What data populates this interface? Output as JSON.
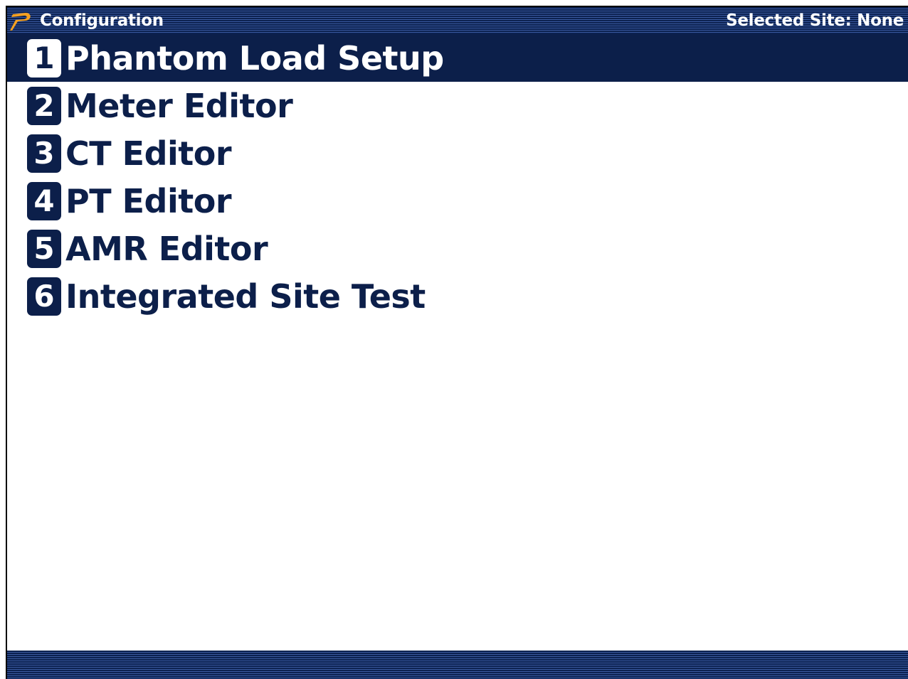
{
  "header": {
    "title": "Configuration",
    "site_status": "Selected Site: None",
    "logo_icon": "p-logo-icon"
  },
  "menu": {
    "selected_index": 0,
    "items": [
      {
        "number": "1",
        "label": "Phantom Load Setup"
      },
      {
        "number": "2",
        "label": "Meter Editor"
      },
      {
        "number": "3",
        "label": "CT Editor"
      },
      {
        "number": "4",
        "label": "PT Editor"
      },
      {
        "number": "5",
        "label": "AMR Editor"
      },
      {
        "number": "6",
        "label": "Integrated Site Test"
      }
    ]
  },
  "colors": {
    "navy": "#0c1f4a",
    "logo_orange": "#f5a020",
    "background": "#ffffff"
  }
}
